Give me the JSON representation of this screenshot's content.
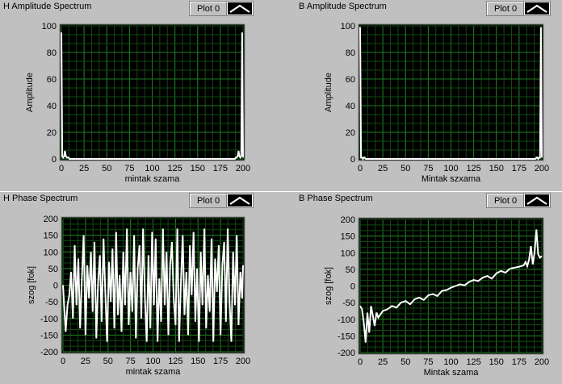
{
  "chart_data": [
    {
      "type": "line",
      "title": "H Amplitude Spectrum",
      "legend": "Plot 0",
      "xlabel": "mintak szama",
      "ylabel": "Amplitude",
      "xlim": [
        0,
        200
      ],
      "ylim": [
        0,
        100
      ],
      "xticks": [
        0,
        25,
        50,
        75,
        100,
        125,
        150,
        175,
        200
      ],
      "yticks": [
        0,
        20,
        40,
        60,
        80,
        100
      ],
      "grid": true,
      "series": [
        {
          "x": [
            0,
            1,
            2,
            3,
            4,
            5,
            6,
            7,
            8,
            9,
            10,
            11,
            12,
            13,
            14,
            15,
            16,
            17,
            18,
            19,
            20,
            60,
            100,
            140,
            180,
            181,
            182,
            183,
            184,
            185,
            186,
            187,
            188,
            189,
            190,
            191,
            192,
            193,
            194,
            195,
            196,
            197,
            198,
            199,
            200
          ],
          "y": [
            95,
            2,
            1,
            2,
            6,
            2,
            1,
            1,
            1,
            0,
            0,
            0,
            0,
            0,
            0,
            0,
            0,
            0,
            0,
            0,
            0,
            0,
            0,
            0,
            0,
            0,
            0,
            0,
            0,
            0,
            0,
            0,
            0,
            0,
            0,
            0,
            1,
            1,
            2,
            6,
            2,
            1,
            2,
            95,
            1
          ]
        }
      ]
    },
    {
      "type": "line",
      "title": "B Amplitude Spectrum",
      "legend": "Plot 0",
      "xlabel": "Mintak szxama",
      "ylabel": "Amplitude",
      "xlim": [
        0,
        200
      ],
      "ylim": [
        0,
        100
      ],
      "xticks": [
        0,
        25,
        50,
        75,
        100,
        125,
        150,
        175,
        200
      ],
      "yticks": [
        0,
        20,
        40,
        60,
        80,
        100
      ],
      "grid": true,
      "series": [
        {
          "x": [
            0,
            1,
            2,
            3,
            4,
            5,
            6,
            100,
            193,
            194,
            195,
            196,
            197,
            198,
            199,
            200
          ],
          "y": [
            99,
            1,
            1,
            0,
            1,
            1,
            0,
            0,
            0,
            1,
            1,
            0,
            1,
            1,
            99,
            1
          ]
        }
      ]
    },
    {
      "type": "line",
      "title": "H Phase Spectrum",
      "legend": "Plot 0",
      "xlabel": "mintak szama",
      "ylabel": "szog [fok]",
      "xlim": [
        0,
        200
      ],
      "ylim": [
        -200,
        200
      ],
      "xticks": [
        0,
        25,
        50,
        75,
        100,
        125,
        150,
        175,
        200
      ],
      "yticks": [
        -200,
        -150,
        -100,
        -50,
        0,
        50,
        100,
        150,
        200
      ],
      "grid": true,
      "series": [
        {
          "x": [
            0,
            3,
            5,
            7,
            9,
            11,
            13,
            15,
            17,
            19,
            21,
            23,
            25,
            27,
            29,
            31,
            33,
            35,
            37,
            39,
            41,
            43,
            45,
            47,
            49,
            51,
            53,
            55,
            57,
            59,
            61,
            63,
            65,
            67,
            69,
            71,
            73,
            75,
            77,
            79,
            81,
            83,
            85,
            87,
            89,
            91,
            93,
            95,
            97,
            99,
            101,
            103,
            105,
            107,
            109,
            111,
            113,
            115,
            117,
            119,
            121,
            123,
            125,
            127,
            129,
            131,
            133,
            135,
            137,
            139,
            141,
            143,
            145,
            147,
            149,
            151,
            153,
            155,
            157,
            159,
            161,
            163,
            165,
            167,
            169,
            171,
            173,
            175,
            177,
            179,
            181,
            183,
            185,
            187,
            189,
            191,
            193,
            195,
            197,
            199,
            200
          ],
          "y": [
            0,
            -140,
            -60,
            -30,
            40,
            -100,
            120,
            -60,
            80,
            -130,
            20,
            150,
            -150,
            60,
            -40,
            100,
            -80,
            130,
            -160,
            10,
            90,
            -110,
            140,
            -20,
            -170,
            70,
            -50,
            110,
            -130,
            160,
            -90,
            30,
            -140,
            100,
            -60,
            170,
            -120,
            40,
            -80,
            150,
            -160,
            50,
            120,
            -100,
            170,
            -40,
            -170,
            90,
            -130,
            160,
            -60,
            140,
            -170,
            20,
            -110,
            170,
            -60,
            100,
            -150,
            60,
            130,
            -40,
            -120,
            170,
            -170,
            10,
            150,
            -90,
            40,
            -150,
            120,
            -30,
            160,
            -110,
            50,
            -170,
            100,
            -60,
            170,
            -130,
            30,
            -80,
            140,
            -170,
            80,
            -20,
            120,
            -150,
            60,
            130,
            -110,
            170,
            -50,
            -170,
            100,
            -60,
            150,
            -120,
            40,
            -40,
            60
          ]
        }
      ]
    },
    {
      "type": "line",
      "title": "B Phase Spectrum",
      "legend": "Plot 0",
      "xlabel": "Mintak szama",
      "ylabel": "szog [fok]",
      "xlim": [
        0,
        200
      ],
      "ylim": [
        -200,
        200
      ],
      "xticks": [
        0,
        25,
        50,
        75,
        100,
        125,
        150,
        175,
        200
      ],
      "yticks": [
        -200,
        -150,
        -100,
        -50,
        0,
        50,
        100,
        150,
        200
      ],
      "grid": true,
      "series": [
        {
          "x": [
            0,
            2,
            4,
            6,
            8,
            10,
            12,
            14,
            16,
            18,
            20,
            25,
            30,
            35,
            40,
            45,
            50,
            55,
            60,
            65,
            70,
            75,
            80,
            85,
            90,
            95,
            100,
            105,
            110,
            115,
            120,
            125,
            130,
            135,
            140,
            145,
            150,
            155,
            160,
            165,
            170,
            175,
            180,
            182,
            184,
            186,
            188,
            190,
            192,
            194,
            196,
            198,
            200
          ],
          "y": [
            -60,
            -70,
            -110,
            -170,
            -80,
            -140,
            -60,
            -90,
            -120,
            -80,
            -95,
            -75,
            -70,
            -60,
            -65,
            -50,
            -45,
            -55,
            -40,
            -35,
            -42,
            -28,
            -24,
            -30,
            -15,
            -12,
            -5,
            0,
            5,
            2,
            12,
            18,
            15,
            25,
            30,
            22,
            38,
            45,
            40,
            52,
            55,
            58,
            62,
            72,
            60,
            80,
            120,
            65,
            100,
            170,
            95,
            85,
            90
          ]
        }
      ]
    }
  ]
}
